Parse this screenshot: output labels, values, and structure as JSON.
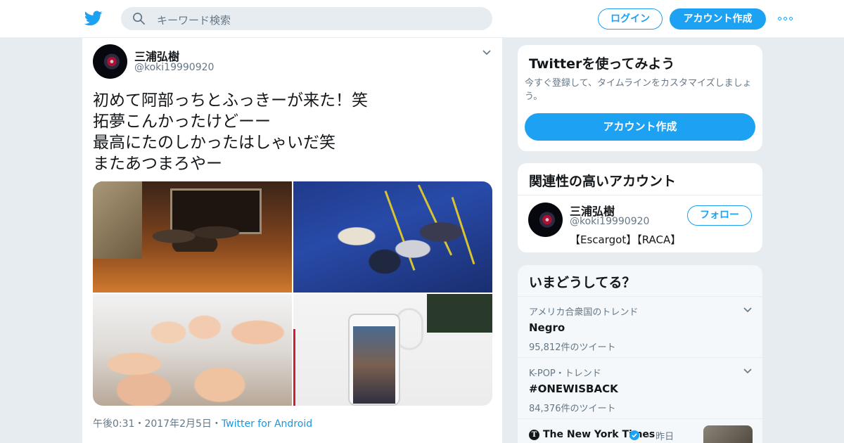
{
  "header": {
    "search_placeholder": "キーワード検索",
    "login_label": "ログイン",
    "signup_label": "アカウント作成"
  },
  "tweet": {
    "author_name": "三浦弘樹",
    "author_handle": "@koki19990920",
    "text_lines": [
      "初めて阿部っちとふっきーが来た！笑",
      "拓夢こんかったけどーー",
      "最高にたのしかったはしゃいだ笑",
      "またあつまろやー"
    ],
    "time": "午後0:31",
    "date": "2017年2月5日",
    "separator": "・",
    "source": "Twitter for Android"
  },
  "signup_card": {
    "title": "Twitterを使ってみよう",
    "subtitle": "今すぐ登録して、タイムラインをカスタマイズしましょう。",
    "button_label": "アカウント作成"
  },
  "related_card": {
    "title": "関連性の高いアカウント",
    "name": "三浦弘樹",
    "handle": "@koki19990920",
    "bio": "【Escargot】【RACA】",
    "follow_label": "フォロー"
  },
  "trends_card": {
    "title": "いまどうしてる？",
    "trends": [
      {
        "context": "アメリカ合衆国のトレンド",
        "name": "Negro",
        "count": "95,812件のツイート"
      },
      {
        "context": "K-POP・トレンド",
        "name": "#ONEWISBACK",
        "count": "84,376件のツイート"
      }
    ],
    "news": {
      "source": "The New York Times",
      "separator": "・",
      "time": "昨日"
    }
  },
  "colors": {
    "accent": "#1da1f2",
    "link": "#1b95e0",
    "secondary_text": "#657786"
  }
}
